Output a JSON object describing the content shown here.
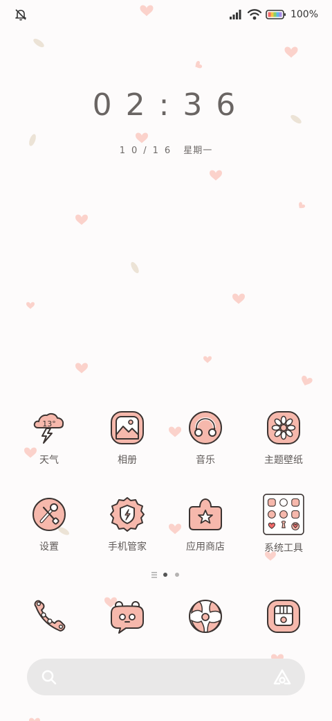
{
  "status_bar": {
    "battery_percent": "100%",
    "icons": [
      "mute-bell-icon",
      "signal-icon",
      "wifi-icon",
      "battery-icon"
    ]
  },
  "clock": {
    "time": "02:36",
    "date": "10/16",
    "weekday": "星期一"
  },
  "apps": [
    {
      "label": "天气",
      "icon": "weather-icon",
      "badge": "13°"
    },
    {
      "label": "相册",
      "icon": "gallery-icon"
    },
    {
      "label": "音乐",
      "icon": "music-headphones-icon"
    },
    {
      "label": "主题壁纸",
      "icon": "theme-flower-icon"
    },
    {
      "label": "设置",
      "icon": "settings-tools-icon"
    },
    {
      "label": "手机管家",
      "icon": "security-shield-icon"
    },
    {
      "label": "应用商店",
      "icon": "app-store-icon"
    },
    {
      "label": "系统工具",
      "icon": "system-tools-folder-icon"
    }
  ],
  "pages": {
    "count": 3,
    "current": 1
  },
  "dock": [
    {
      "icon": "phone-icon"
    },
    {
      "icon": "messages-icon"
    },
    {
      "icon": "browser-icon"
    },
    {
      "icon": "camera-icon"
    }
  ],
  "search": {
    "placeholder": ""
  },
  "colors": {
    "accent_pink": "#f6b8ac",
    "outline": "#3b3331",
    "text": "#5f5a58",
    "background": "#fdfbfb"
  }
}
